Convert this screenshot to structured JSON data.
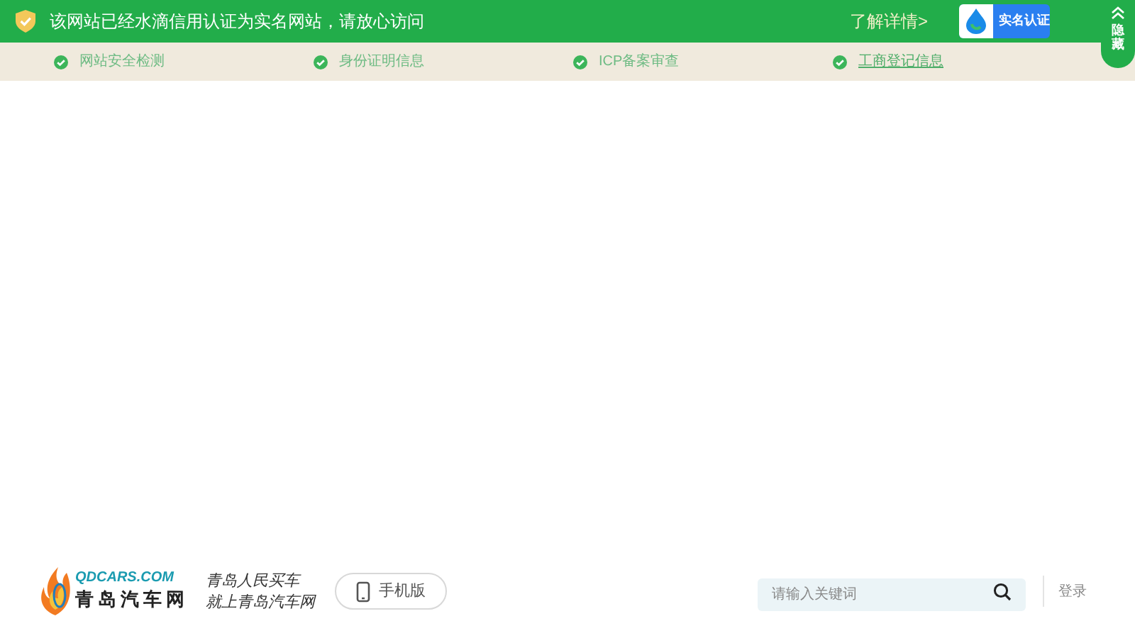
{
  "banner": {
    "message": "该网站已经水滴信用认证为实名网站，请放心访问",
    "details_link": "了解详情>",
    "badge": "实名认证",
    "hide_tab": "隐藏"
  },
  "checks": [
    {
      "label": "网站安全检测",
      "kind": "text"
    },
    {
      "label": "身份证明信息",
      "kind": "text"
    },
    {
      "label": "ICP备案审查",
      "kind": "text"
    },
    {
      "label": "工商登记信息",
      "kind": "link"
    }
  ],
  "footer": {
    "logo_domain": "QDCARS.COM",
    "logo_name": "青岛汽车网",
    "slogan": [
      "青岛人民买车",
      "就上青岛汽车网"
    ],
    "mobile_button": "手机版",
    "search": {
      "placeholder": "请输入关键词"
    },
    "login": "登录"
  }
}
